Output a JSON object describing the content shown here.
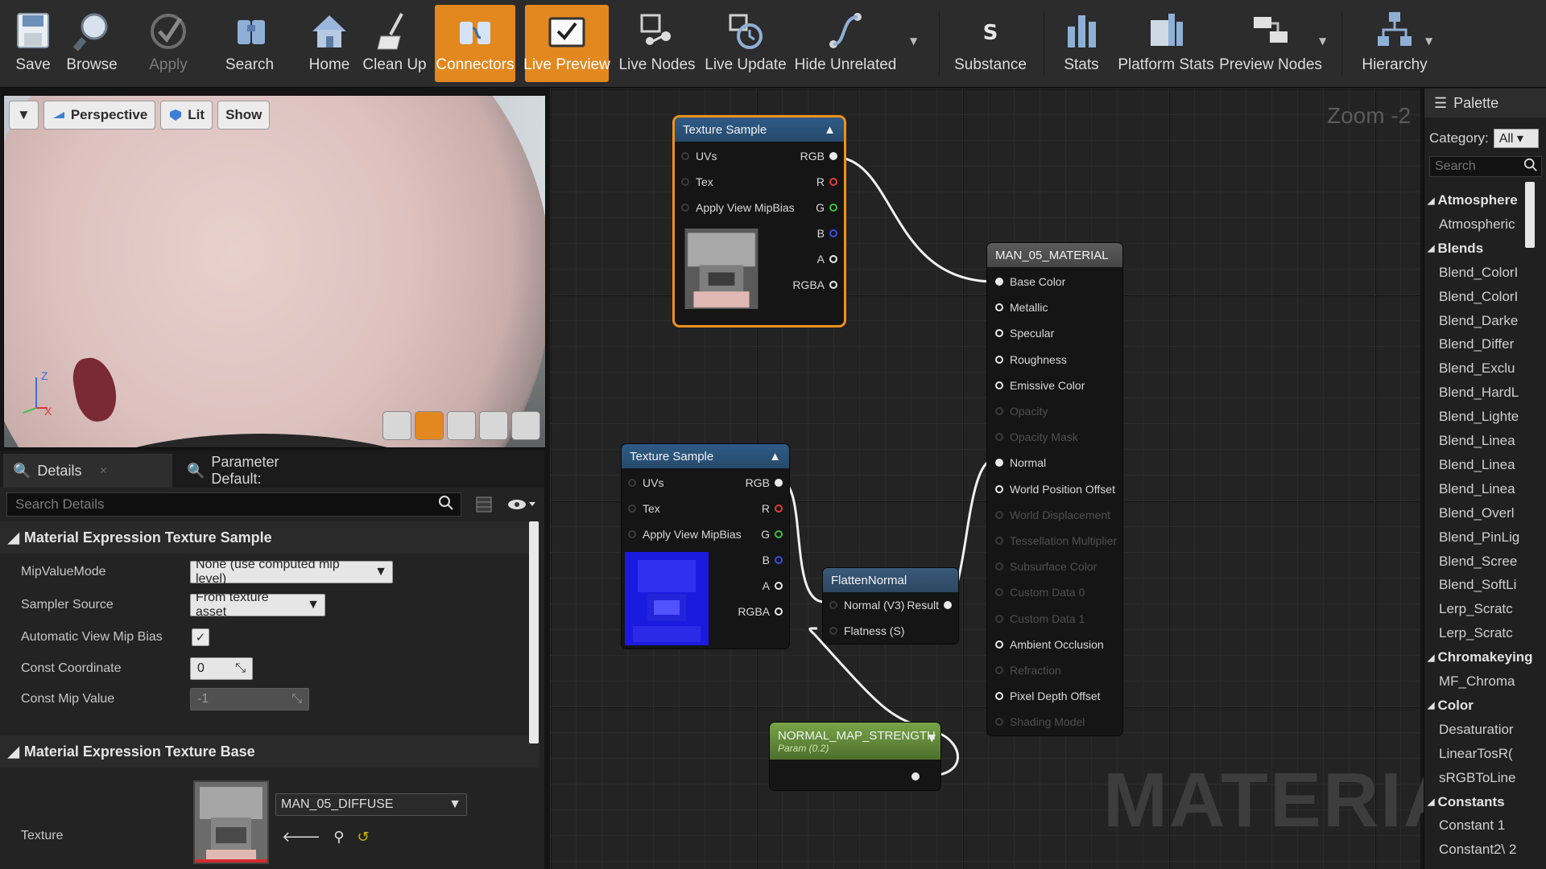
{
  "toolbar": {
    "buttons": [
      {
        "label": "Save",
        "icon": "save-icon"
      },
      {
        "label": "Browse",
        "icon": "browse-icon"
      },
      {
        "label": "Apply",
        "icon": "apply-icon",
        "disabled": true
      },
      {
        "label": "Search",
        "icon": "search-icon"
      },
      {
        "label": "Home",
        "icon": "home-icon"
      },
      {
        "label": "Clean Up",
        "icon": "clean-up-icon"
      },
      {
        "label": "Connectors",
        "icon": "connectors-icon",
        "active": true
      },
      {
        "label": "Live Preview",
        "icon": "live-preview-icon",
        "active": true
      },
      {
        "label": "Live Nodes",
        "icon": "live-nodes-icon"
      },
      {
        "label": "Live Update",
        "icon": "live-update-icon"
      },
      {
        "label": "Hide Unrelated",
        "icon": "hide-unrelated-icon"
      },
      {
        "label": "Substance",
        "icon": "substance-icon"
      },
      {
        "label": "Stats",
        "icon": "stats-icon"
      },
      {
        "label": "Platform Stats",
        "icon": "platform-stats-icon"
      },
      {
        "label": "Preview Nodes",
        "icon": "preview-nodes-icon"
      },
      {
        "label": "Hierarchy",
        "icon": "hierarchy-icon"
      }
    ],
    "active_color": "#e2881f"
  },
  "viewport": {
    "perspective_label": "Perspective",
    "lit_label": "Lit",
    "show_label": "Show",
    "axis_z": "Z",
    "axis_x": "X"
  },
  "details": {
    "tabs": [
      "Details",
      "Parameter Default:"
    ],
    "search_placeholder": "Search Details",
    "sections": [
      {
        "title": "Material Expression Texture Sample",
        "rows": [
          {
            "label": "MipValueMode",
            "value": "None (use computed mip level)"
          },
          {
            "label": "Sampler Source",
            "value": "From texture asset"
          },
          {
            "label": "Automatic View Mip Bias",
            "checked": true
          },
          {
            "label": "Const Coordinate",
            "value": "0"
          },
          {
            "label": "Const Mip Value",
            "value": "-1"
          }
        ]
      },
      {
        "title": "Material Expression Texture Base",
        "rows": [
          {
            "label": "Texture",
            "value": "MAN_05_DIFFUSE"
          }
        ]
      }
    ]
  },
  "graph": {
    "zoom": "Zoom -2",
    "watermark": "MATERIAL",
    "texture_sample_1": {
      "title": "Texture Sample",
      "inputs": [
        "UVs",
        "Tex",
        "Apply View MipBias"
      ],
      "outputs": [
        "RGB",
        "R",
        "G",
        "B",
        "A",
        "RGBA"
      ]
    },
    "texture_sample_2": {
      "title": "Texture Sample",
      "inputs": [
        "UVs",
        "Tex",
        "Apply View MipBias"
      ],
      "outputs": [
        "RGB",
        "R",
        "G",
        "B",
        "A",
        "RGBA"
      ]
    },
    "flatten_normal": {
      "title": "FlattenNormal",
      "inputs": [
        "Normal (V3)",
        "Flatness (S)"
      ],
      "output": "Result"
    },
    "param": {
      "title": "NORMAL_MAP_STRENGTH",
      "subtitle": "Param (0.2)"
    },
    "material": {
      "title": "MAN_05_MATERIAL",
      "pins": [
        {
          "label": "Base Color",
          "active": true,
          "connected": true
        },
        {
          "label": "Metallic",
          "active": true
        },
        {
          "label": "Specular",
          "active": true
        },
        {
          "label": "Roughness",
          "active": true
        },
        {
          "label": "Emissive Color",
          "active": true
        },
        {
          "label": "Opacity",
          "active": false
        },
        {
          "label": "Opacity Mask",
          "active": false
        },
        {
          "label": "Normal",
          "active": true,
          "connected": true
        },
        {
          "label": "World Position Offset",
          "active": true
        },
        {
          "label": "World Displacement",
          "active": false
        },
        {
          "label": "Tessellation Multiplier",
          "active": false
        },
        {
          "label": "Subsurface Color",
          "active": false
        },
        {
          "label": "Custom Data 0",
          "active": false
        },
        {
          "label": "Custom Data 1",
          "active": false
        },
        {
          "label": "Ambient Occlusion",
          "active": true
        },
        {
          "label": "Refraction",
          "active": false
        },
        {
          "label": "Pixel Depth Offset",
          "active": true
        },
        {
          "label": "Shading Model",
          "active": false
        }
      ]
    }
  },
  "palette": {
    "title": "Palette",
    "category_label": "Category:",
    "category_value": "All",
    "search_placeholder": "Search",
    "entries": [
      {
        "group": "Atmosphere"
      },
      {
        "item": "Atmospheric"
      },
      {
        "group": "Blends"
      },
      {
        "item": "Blend_ColorI"
      },
      {
        "item": "Blend_ColorI"
      },
      {
        "item": "Blend_Darke"
      },
      {
        "item": "Blend_Differ"
      },
      {
        "item": "Blend_Exclu"
      },
      {
        "item": "Blend_HardL"
      },
      {
        "item": "Blend_Lighte"
      },
      {
        "item": "Blend_Linea"
      },
      {
        "item": "Blend_Linea"
      },
      {
        "item": "Blend_Linea"
      },
      {
        "item": "Blend_Overl"
      },
      {
        "item": "Blend_PinLig"
      },
      {
        "item": "Blend_Scree"
      },
      {
        "item": "Blend_SoftLi"
      },
      {
        "item": "Lerp_Scratc"
      },
      {
        "item": "Lerp_Scratc"
      },
      {
        "group": "Chromakeying"
      },
      {
        "item": "MF_Chroma"
      },
      {
        "group": "Color"
      },
      {
        "item": "Desaturatior"
      },
      {
        "item": "LinearTosR("
      },
      {
        "item": "sRGBToLine"
      },
      {
        "group": "Constants"
      },
      {
        "item": "Constant     1"
      },
      {
        "item": "Constant2\\ 2"
      }
    ]
  }
}
